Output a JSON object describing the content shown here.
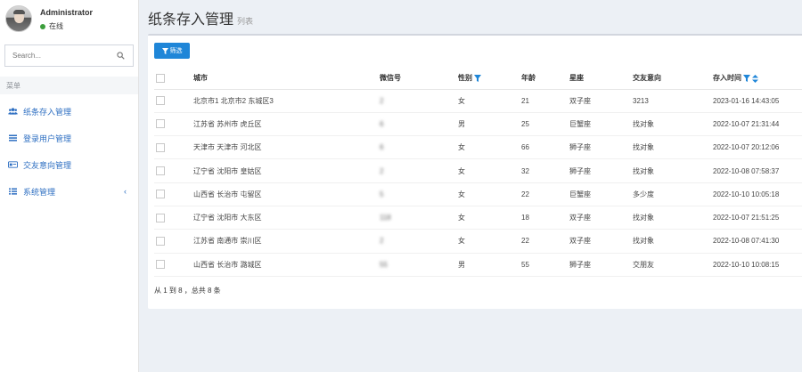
{
  "user": {
    "name": "Administrator",
    "status": "在线"
  },
  "search": {
    "placeholder": "Search..."
  },
  "menu": {
    "header": "菜单",
    "items": [
      {
        "label": "纸条存入管理",
        "icon": "users-icon"
      },
      {
        "label": "登录用户管理",
        "icon": "list-icon"
      },
      {
        "label": "交友意向管理",
        "icon": "card-icon"
      },
      {
        "label": "系统管理",
        "icon": "list-icon",
        "caret": "‹"
      }
    ]
  },
  "page": {
    "title": "纸条存入管理",
    "subtitle": "列表"
  },
  "toolbar": {
    "filter_label": "筛选"
  },
  "table": {
    "headers": {
      "city": "城市",
      "wechat": "微信号",
      "gender": "性别",
      "age": "年龄",
      "star": "星座",
      "intent": "交友意向",
      "time": "存入时间"
    },
    "rows": [
      {
        "city": "北京市1 北京市2 东城区3",
        "wechat": "2",
        "gender": "女",
        "age": "21",
        "star": "双子座",
        "intent": "3213",
        "time": "2023-01-16 14:43:05"
      },
      {
        "city": "江苏省 苏州市 虎丘区",
        "wechat": "6",
        "gender": "男",
        "age": "25",
        "star": "巨蟹座",
        "intent": "找对象",
        "time": "2022-10-07 21:31:44"
      },
      {
        "city": "天津市 天津市 河北区",
        "wechat": "6",
        "gender": "女",
        "age": "66",
        "star": "狮子座",
        "intent": "找对象",
        "time": "2022-10-07 20:12:06"
      },
      {
        "city": "辽宁省 沈阳市 皇姑区",
        "wechat": "2",
        "gender": "女",
        "age": "32",
        "star": "狮子座",
        "intent": "找对象",
        "time": "2022-10-08 07:58:37"
      },
      {
        "city": "山西省 长治市 屯留区",
        "wechat": "5",
        "gender": "女",
        "age": "22",
        "star": "巨蟹座",
        "intent": "多少度",
        "time": "2022-10-10 10:05:18"
      },
      {
        "city": "辽宁省 沈阳市 大东区",
        "wechat": "118",
        "gender": "女",
        "age": "18",
        "star": "双子座",
        "intent": "找对象",
        "time": "2022-10-07 21:51:25"
      },
      {
        "city": "江苏省 南通市 崇川区",
        "wechat": "2",
        "gender": "女",
        "age": "22",
        "star": "双子座",
        "intent": "找对象",
        "time": "2022-10-08 07:41:30"
      },
      {
        "city": "山西省 长治市 潞城区",
        "wechat": "55",
        "gender": "男",
        "age": "55",
        "star": "狮子座",
        "intent": "交朋友",
        "time": "2022-10-10 10:08:15"
      }
    ]
  },
  "pagination": {
    "info": "从 1 到 8 ，总共 8 条"
  },
  "colors": {
    "accent": "#1f86d8",
    "menu_text": "#2e6fc2",
    "online": "#3c9e3c"
  }
}
